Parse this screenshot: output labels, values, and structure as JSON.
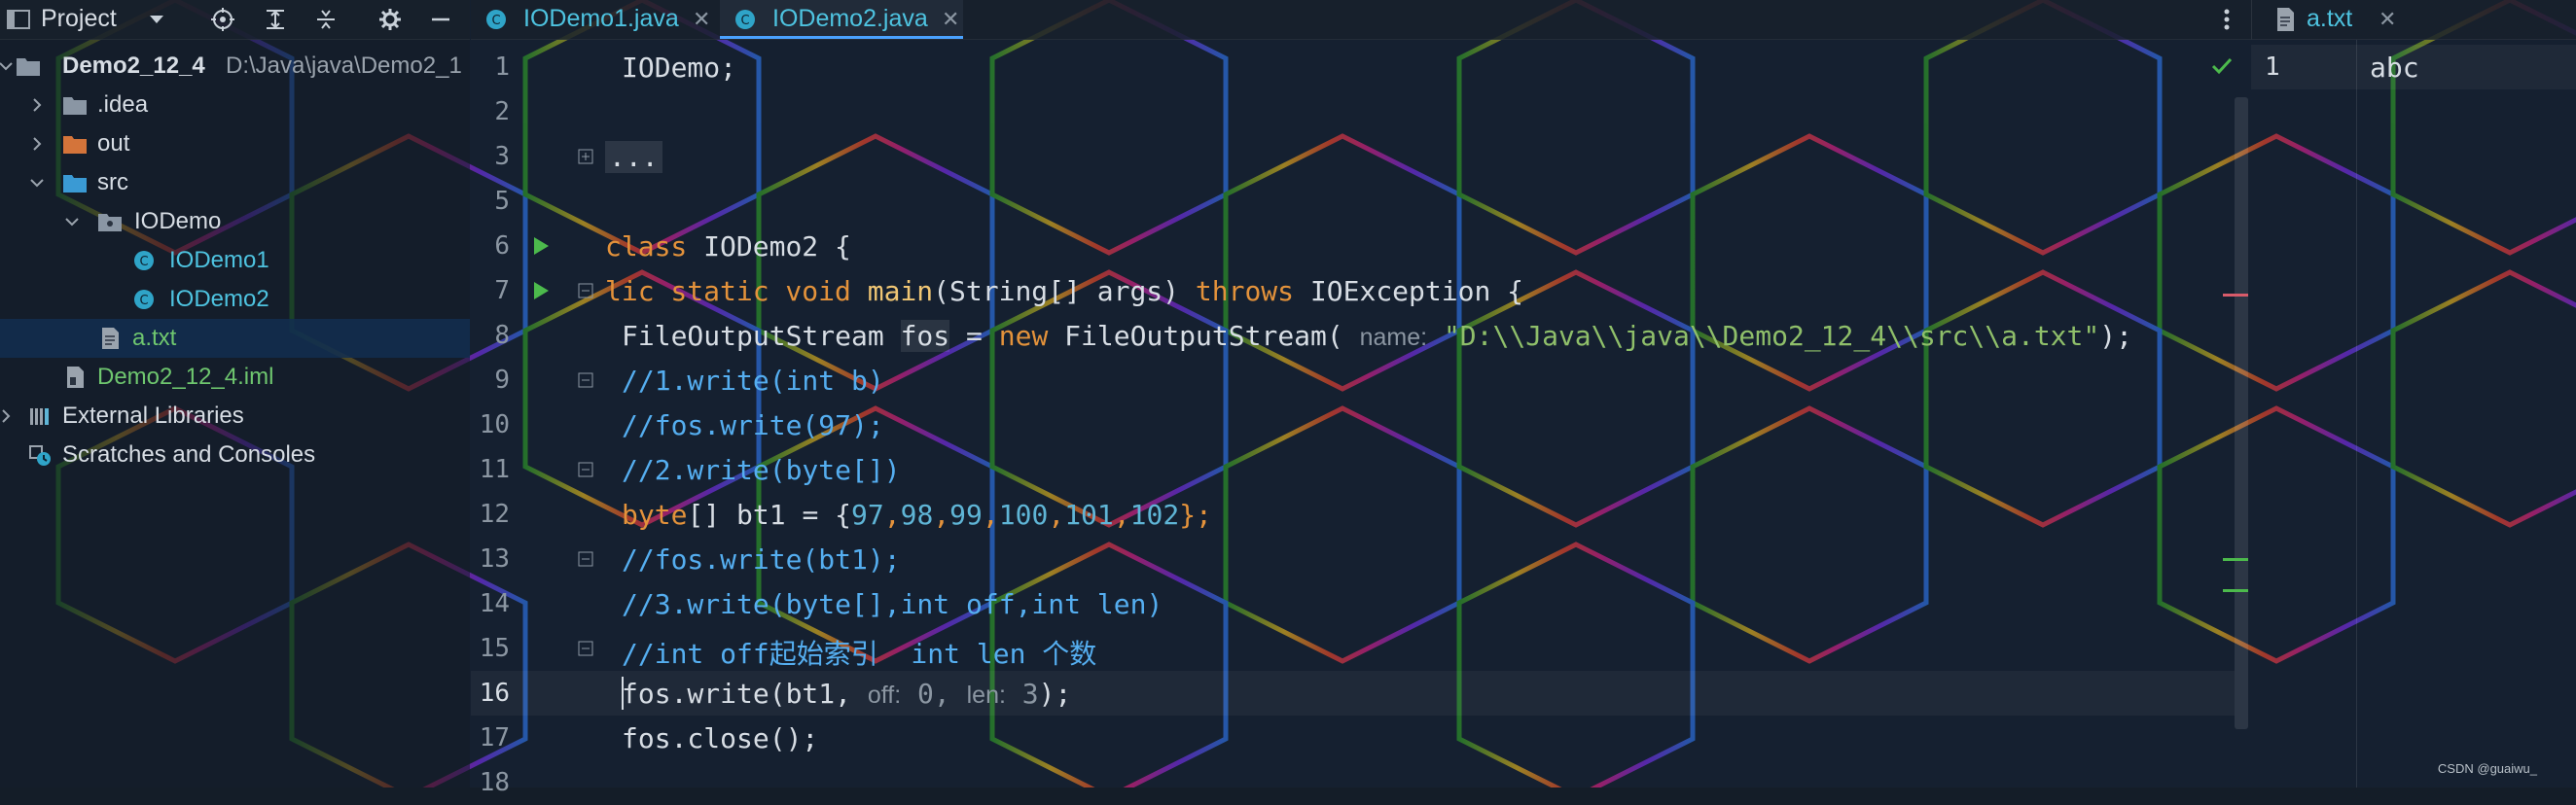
{
  "project_panel": {
    "title": "Project",
    "tree": [
      {
        "label": "Demo2_12_4",
        "sub": "D:\\Java\\java\\Demo2_1"
      },
      {
        "label": ".idea"
      },
      {
        "label": "out"
      },
      {
        "label": "src"
      },
      {
        "label": "IODemo"
      },
      {
        "label": "IODemo1"
      },
      {
        "label": "IODemo2"
      },
      {
        "label": "a.txt"
      },
      {
        "label": "Demo2_12_4.iml"
      },
      {
        "label": "External Libraries"
      },
      {
        "label": "Scratches and Consoles"
      }
    ]
  },
  "editor_tabs": [
    {
      "label": "IODemo1.java"
    },
    {
      "label": "IODemo2.java"
    }
  ],
  "right_tab": {
    "label": "a.txt"
  },
  "right_content": {
    "line": "1",
    "text": "abc"
  },
  "line_numbers": [
    "1",
    "2",
    "3",
    "5",
    "6",
    "7",
    "8",
    "9",
    "10",
    "11",
    "12",
    "13",
    "14",
    "15",
    "16",
    "17",
    "18"
  ],
  "code": {
    "l1": "IODemo;",
    "l3": "...",
    "l6a": "class",
    "l6b": " IODemo2 {",
    "l7a": "lic static void ",
    "l7b": "main",
    "l7c": "(String[] args) ",
    "l7d": "throws",
    "l7e": " IOException {",
    "l8a": "FileOutputStream ",
    "l8b": "fos",
    "l8c": " = ",
    "l8d": "new",
    "l8e": " FileOutputStream( ",
    "l8f": "name:",
    "l8g": " \"D:\\\\Java\\\\java\\\\Demo2_12_4\\\\src\\\\a.txt\"",
    "l8h": ");",
    "l9": "//1.write(int b)",
    "l10": "//fos.write(97);",
    "l11": "//2.write(byte[])",
    "l12a": "byte",
    "l12b": "[] bt1 = {",
    "l12c": "97",
    "l12d": ",",
    "l12e": "98",
    "l12f": ",",
    "l12g": "99",
    "l12h": ",",
    "l12i": "100",
    "l12j": ",",
    "l12k": "101",
    "l12l": ",",
    "l12m": "102",
    "l12n": "};",
    "l13": "//fos.write(bt1);",
    "l14": "//3.write(byte[],int off,int len)",
    "l15": "//int off起始索引  int len 个数",
    "l16a": "fos.write(bt1, ",
    "l16b": "off:",
    "l16c": " 0",
    "l16d": ", ",
    "l16e": "len:",
    "l16f": " 3",
    "l16g": ");",
    "l17": "fos.close();"
  },
  "watermark": "CSDN @guaiwu_",
  "colors": {
    "keyword": "#e3923b",
    "comment": "#55aef0",
    "string": "#8fbf6a",
    "accent": "#4aa2ff"
  }
}
